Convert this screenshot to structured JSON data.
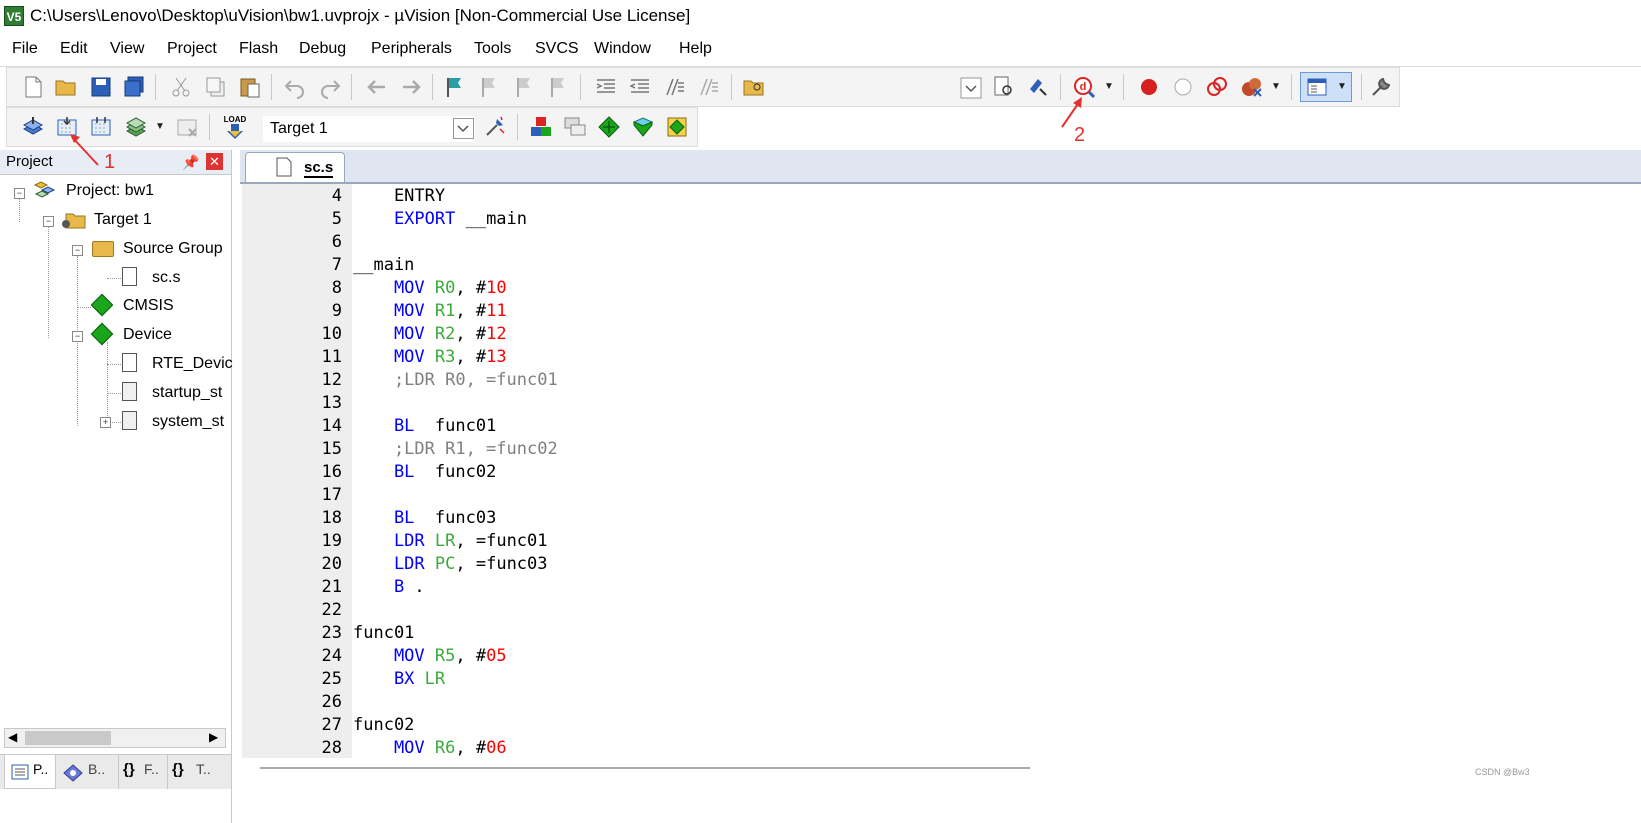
{
  "window": {
    "title": "C:\\Users\\Lenovo\\Desktop\\uVision\\bw1.uvprojx - µVision  [Non-Commercial Use License]",
    "icon_label": "V5"
  },
  "menu": [
    "File",
    "Edit",
    "View",
    "Project",
    "Flash",
    "Debug",
    "Peripherals",
    "Tools",
    "SVCS",
    "Window",
    "Help"
  ],
  "build_toolbar": {
    "load_label": "LOAD",
    "target_select": "Target 1"
  },
  "project_panel": {
    "title": "Project",
    "tree": {
      "project": "Project: bw1",
      "target": "Target 1",
      "source_group": "Source Group",
      "source_file": "sc.s",
      "cmsis": "CMSIS",
      "device": "Device",
      "device_files": [
        "RTE_Devic",
        "startup_st",
        "system_st"
      ]
    },
    "bottom_tabs": [
      "P..",
      "B..",
      "F..",
      "T.."
    ],
    "bottom_tab_glyphs": [
      "{}",
      "{}"
    ]
  },
  "editor": {
    "tab_label": "sc.s",
    "lines": [
      {
        "n": "4",
        "tokens": [
          [
            "    ENTRY",
            "def"
          ]
        ]
      },
      {
        "n": "5",
        "tokens": [
          [
            "    EXPORT",
            "kw"
          ],
          [
            " __main",
            "def"
          ]
        ]
      },
      {
        "n": "6",
        "tokens": []
      },
      {
        "n": "7",
        "tokens": [
          [
            "__main",
            "def"
          ]
        ]
      },
      {
        "n": "8",
        "tokens": [
          [
            "    MOV",
            "kw"
          ],
          [
            " ",
            "def"
          ],
          [
            "R0",
            "reg"
          ],
          [
            ", #",
            "def"
          ],
          [
            "10",
            "num"
          ]
        ]
      },
      {
        "n": "9",
        "tokens": [
          [
            "    MOV",
            "kw"
          ],
          [
            " ",
            "def"
          ],
          [
            "R1",
            "reg"
          ],
          [
            ", #",
            "def"
          ],
          [
            "11",
            "num"
          ]
        ]
      },
      {
        "n": "10",
        "tokens": [
          [
            "    MOV",
            "kw"
          ],
          [
            " ",
            "def"
          ],
          [
            "R2",
            "reg"
          ],
          [
            ", #",
            "def"
          ],
          [
            "12",
            "num"
          ]
        ]
      },
      {
        "n": "11",
        "tokens": [
          [
            "    MOV",
            "kw"
          ],
          [
            " ",
            "def"
          ],
          [
            "R3",
            "reg"
          ],
          [
            ", #",
            "def"
          ],
          [
            "13",
            "num"
          ]
        ]
      },
      {
        "n": "12",
        "tokens": [
          [
            "    ;LDR R0, =func01",
            "cmt"
          ]
        ]
      },
      {
        "n": "13",
        "tokens": []
      },
      {
        "n": "14",
        "tokens": [
          [
            "    BL",
            "kw"
          ],
          [
            "  func01",
            "def"
          ]
        ]
      },
      {
        "n": "15",
        "tokens": [
          [
            "    ;LDR R1, =func02",
            "cmt"
          ]
        ]
      },
      {
        "n": "16",
        "tokens": [
          [
            "    BL",
            "kw"
          ],
          [
            "  func02",
            "def"
          ]
        ]
      },
      {
        "n": "17",
        "tokens": []
      },
      {
        "n": "18",
        "tokens": [
          [
            "    BL",
            "kw"
          ],
          [
            "  func03",
            "def"
          ]
        ]
      },
      {
        "n": "19",
        "tokens": [
          [
            "    LDR",
            "kw"
          ],
          [
            " ",
            "def"
          ],
          [
            "LR",
            "reg"
          ],
          [
            ", =func01",
            "def"
          ]
        ]
      },
      {
        "n": "20",
        "tokens": [
          [
            "    LDR",
            "kw"
          ],
          [
            " ",
            "def"
          ],
          [
            "PC",
            "reg"
          ],
          [
            ", =func03",
            "def"
          ]
        ]
      },
      {
        "n": "21",
        "tokens": [
          [
            "    B",
            "kw"
          ],
          [
            " .",
            "def"
          ]
        ]
      },
      {
        "n": "22",
        "tokens": []
      },
      {
        "n": "23",
        "tokens": [
          [
            "func01",
            "def"
          ]
        ]
      },
      {
        "n": "24",
        "tokens": [
          [
            "    MOV",
            "kw"
          ],
          [
            " ",
            "def"
          ],
          [
            "R5",
            "reg"
          ],
          [
            ", #",
            "def"
          ],
          [
            "05",
            "num"
          ]
        ]
      },
      {
        "n": "25",
        "tokens": [
          [
            "    BX",
            "kw"
          ],
          [
            " ",
            "def"
          ],
          [
            "LR",
            "reg"
          ]
        ]
      },
      {
        "n": "26",
        "tokens": []
      },
      {
        "n": "27",
        "tokens": [
          [
            "func02",
            "def"
          ]
        ]
      },
      {
        "n": "28",
        "tokens": [
          [
            "    MOV",
            "kw"
          ],
          [
            " ",
            "def"
          ],
          [
            "R6",
            "reg"
          ],
          [
            ", #",
            "def"
          ],
          [
            "06",
            "num"
          ]
        ]
      }
    ]
  },
  "annotations": [
    "1",
    "2"
  ],
  "watermark": "CSDN @Bw3",
  "colors": {
    "keyword": "#0000ff",
    "register": "#3cab3c",
    "number": "#ff0000",
    "comment": "#808080",
    "annotation": "#e53030"
  }
}
